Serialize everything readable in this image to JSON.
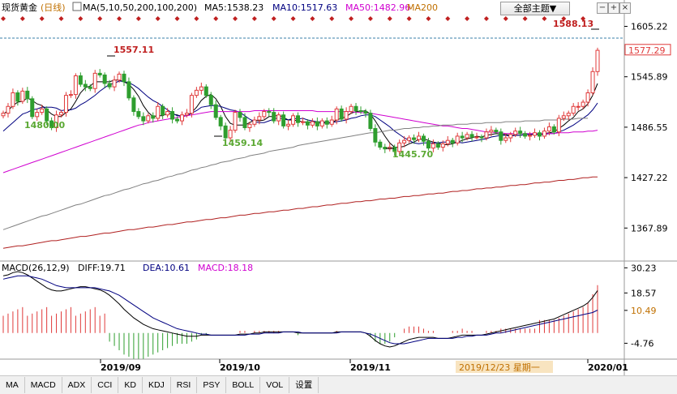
{
  "header": {
    "instrument": "现货黄金",
    "period": "(日线)",
    "ma_label": "MA(5,10,50,200,100,200)",
    "ma5": "MA5:1538.23",
    "ma10": "MA10:1517.63",
    "ma50": "MA50:1482.96",
    "ma200": "MA200",
    "theme_button": "全部主题▼",
    "ctl_minus": "−",
    "ctl_plus": "+",
    "ctl_close": "×"
  },
  "macd_header": {
    "name": "MACD(26,12,9)",
    "diff": "DIFF:19.71",
    "dea": "DEA:10.61",
    "macd": "MACD:18.18"
  },
  "annotations": {
    "high_left": "1557.11",
    "low_a": "1480.00",
    "low_b": "1459.14",
    "low_c": "1445.70",
    "high_right": "1588.13",
    "cursor_date": "2019/12/23 星期一"
  },
  "price_axis": [
    "1605.22",
    "1545.89",
    "1486.55",
    "1427.22",
    "1367.89"
  ],
  "current_price": "1577.29",
  "macd_axis": [
    "30.23",
    "18.57",
    "10.49",
    "-4.76"
  ],
  "date_axis": [
    "2019/09",
    "2019/10",
    "2019/11",
    "2020/01"
  ],
  "toolbar": [
    "MA",
    "MACD",
    "ADX",
    "CCI",
    "KD",
    "KDJ",
    "RSI",
    "PSY",
    "BOLL",
    "VOL",
    "设置"
  ],
  "colors": {
    "up": "#e03a3a",
    "down": "#2e9e2e",
    "ma5": "#000000",
    "ma10": "#000080",
    "ma50": "#d000d0",
    "ma100": "#808080",
    "ma200": "#b02020",
    "diff": "#000000",
    "dea": "#000080",
    "axis_text": "#000000",
    "annot_green": "#5aa832"
  },
  "chart_data": {
    "type": "candlestick",
    "y_range": [
      1330,
      1620
    ],
    "macd_range": [
      -11,
      33
    ],
    "closes": [
      1503,
      1511,
      1527,
      1517,
      1529,
      1520,
      1499,
      1504,
      1508,
      1494,
      1486,
      1501,
      1504,
      1524,
      1525,
      1547,
      1537,
      1534,
      1532,
      1550,
      1548,
      1538,
      1534,
      1542,
      1549,
      1540,
      1521,
      1505,
      1499,
      1494,
      1500,
      1497,
      1511,
      1501,
      1505,
      1496,
      1494,
      1501,
      1503,
      1524,
      1530,
      1534,
      1524,
      1513,
      1498,
      1488,
      1474,
      1483,
      1504,
      1498,
      1486,
      1490,
      1495,
      1499,
      1505,
      1504,
      1494,
      1501,
      1488,
      1490,
      1500,
      1492,
      1493,
      1489,
      1493,
      1488,
      1494,
      1490,
      1495,
      1508,
      1496,
      1505,
      1511,
      1506,
      1505,
      1503,
      1485,
      1469,
      1463,
      1461,
      1463,
      1458,
      1468,
      1471,
      1474,
      1472,
      1476,
      1470,
      1462,
      1467,
      1463,
      1467,
      1471,
      1468,
      1476,
      1474,
      1478,
      1475,
      1475,
      1474,
      1481,
      1483,
      1481,
      1471,
      1474,
      1478,
      1482,
      1479,
      1476,
      1477,
      1480,
      1476,
      1482,
      1487,
      1481,
      1497,
      1500,
      1503,
      1511,
      1511,
      1516,
      1527,
      1552,
      1577
    ],
    "series": [
      {
        "name": "MA5",
        "values": [
          1502,
          1506,
          1512,
          1516,
          1517,
          1521,
          1518,
          1514,
          1512,
          1507,
          1502,
          1499,
          1499,
          1504,
          1508,
          1517,
          1527,
          1533,
          1535,
          1540,
          1540,
          1540,
          1540,
          1542,
          1542,
          1540,
          1537,
          1531,
          1523,
          1512,
          1504,
          1499,
          1500,
          1500,
          1503,
          1502,
          1501,
          1499,
          1500,
          1504,
          1510,
          1518,
          1523,
          1525,
          1520,
          1511,
          1499,
          1491,
          1489,
          1489,
          1489,
          1492,
          1495,
          1494,
          1495,
          1499,
          1499,
          1501,
          1498,
          1495,
          1495,
          1494,
          1493,
          1492,
          1493,
          1491,
          1492,
          1491,
          1492,
          1495,
          1497,
          1499,
          1503,
          1505,
          1505,
          1506,
          1502,
          1494,
          1485,
          1476,
          1468,
          1463,
          1463,
          1464,
          1467,
          1469,
          1472,
          1473,
          1471,
          1469,
          1468,
          1466,
          1466,
          1467,
          1469,
          1471,
          1473,
          1474,
          1476,
          1475,
          1477,
          1478,
          1479,
          1478,
          1478,
          1477,
          1477,
          1477,
          1478,
          1478,
          1479,
          1478,
          1479,
          1480,
          1481,
          1485,
          1489,
          1494,
          1498,
          1505,
          1508,
          1514,
          1524,
          1538
        ]
      },
      {
        "name": "MA10",
        "values": [
          1482,
          1487,
          1492,
          1497,
          1502,
          1504,
          1507,
          1508,
          1510,
          1510,
          1510,
          1509,
          1506,
          1507,
          1507,
          1509,
          1513,
          1516,
          1520,
          1524,
          1529,
          1533,
          1537,
          1538,
          1541,
          1540,
          1539,
          1536,
          1532,
          1527,
          1522,
          1518,
          1515,
          1511,
          1507,
          1503,
          1500,
          1500,
          1500,
          1503,
          1506,
          1510,
          1511,
          1512,
          1512,
          1511,
          1509,
          1507,
          1506,
          1504,
          1500,
          1496,
          1493,
          1492,
          1492,
          1494,
          1496,
          1498,
          1496,
          1495,
          1497,
          1496,
          1497,
          1495,
          1494,
          1493,
          1493,
          1492,
          1492,
          1493,
          1494,
          1495,
          1497,
          1498,
          1500,
          1501,
          1501,
          1499,
          1495,
          1491,
          1487,
          1482,
          1478,
          1474,
          1471,
          1468,
          1467,
          1468,
          1468,
          1468,
          1468,
          1469,
          1469,
          1469,
          1469,
          1468,
          1469,
          1470,
          1471,
          1472,
          1473,
          1475,
          1476,
          1477,
          1477,
          1476,
          1477,
          1477,
          1478,
          1478,
          1478,
          1478,
          1478,
          1479,
          1479,
          1481,
          1483,
          1486,
          1489,
          1493,
          1497,
          1501,
          1507,
          1515
        ]
      },
      {
        "name": "MA50",
        "values": [
          1433,
          1435,
          1437,
          1439,
          1441,
          1443,
          1445,
          1447,
          1449,
          1451,
          1453,
          1455,
          1457,
          1459,
          1461,
          1463,
          1465,
          1467,
          1469,
          1471,
          1473,
          1475,
          1477,
          1479,
          1481,
          1483,
          1485,
          1487,
          1489,
          1490,
          1492,
          1493,
          1494,
          1495,
          1496,
          1497,
          1498,
          1499,
          1500,
          1501,
          1502,
          1503,
          1504,
          1505,
          1505,
          1505,
          1505,
          1505,
          1505,
          1505,
          1505,
          1505,
          1506,
          1506,
          1506,
          1506,
          1506,
          1506,
          1506,
          1506,
          1506,
          1506,
          1506,
          1506,
          1506,
          1505,
          1505,
          1505,
          1505,
          1505,
          1505,
          1505,
          1505,
          1504,
          1504,
          1503,
          1503,
          1502,
          1501,
          1500,
          1499,
          1498,
          1497,
          1496,
          1495,
          1494,
          1493,
          1492,
          1491,
          1490,
          1489,
          1488,
          1488,
          1487,
          1486,
          1485,
          1485,
          1484,
          1483,
          1482,
          1481,
          1481,
          1480,
          1480,
          1479,
          1479,
          1479,
          1479,
          1479,
          1479,
          1479,
          1479,
          1479,
          1479,
          1479,
          1480,
          1480,
          1480,
          1481,
          1481,
          1481,
          1482,
          1482,
          1483
        ]
      },
      {
        "name": "MA100",
        "values": [
          1366,
          1368,
          1370,
          1372,
          1374,
          1376,
          1378,
          1380,
          1382,
          1383,
          1385,
          1387,
          1389,
          1391,
          1393,
          1395,
          1396,
          1398,
          1400,
          1402,
          1404,
          1406,
          1407,
          1409,
          1411,
          1413,
          1414,
          1416,
          1418,
          1420,
          1421,
          1423,
          1424,
          1426,
          1428,
          1429,
          1431,
          1432,
          1434,
          1436,
          1437,
          1439,
          1440,
          1442,
          1443,
          1445,
          1446,
          1447,
          1449,
          1450,
          1451,
          1453,
          1454,
          1455,
          1456,
          1458,
          1459,
          1460,
          1461,
          1462,
          1463,
          1465,
          1466,
          1467,
          1468,
          1469,
          1470,
          1471,
          1472,
          1473,
          1474,
          1475,
          1476,
          1477,
          1478,
          1479,
          1480,
          1480,
          1481,
          1482,
          1483,
          1483,
          1484,
          1485,
          1485,
          1486,
          1486,
          1487,
          1487,
          1488,
          1488,
          1489,
          1489,
          1489,
          1490,
          1490,
          1490,
          1491,
          1491,
          1491,
          1492,
          1492,
          1492,
          1492,
          1493,
          1493,
          1493,
          1493,
          1494,
          1494,
          1494,
          1494,
          1495,
          1495,
          1495,
          1495,
          1496,
          1496,
          1496,
          1497,
          1497,
          1497
        ]
      },
      {
        "name": "MA200",
        "values": [
          1344,
          1345,
          1346,
          1347,
          1347,
          1348,
          1349,
          1350,
          1351,
          1352,
          1353,
          1353,
          1354,
          1355,
          1356,
          1357,
          1358,
          1358,
          1359,
          1360,
          1361,
          1362,
          1362,
          1363,
          1364,
          1365,
          1366,
          1366,
          1367,
          1368,
          1369,
          1369,
          1370,
          1371,
          1372,
          1372,
          1373,
          1374,
          1375,
          1375,
          1376,
          1377,
          1378,
          1378,
          1379,
          1380,
          1380,
          1381,
          1382,
          1383,
          1383,
          1384,
          1385,
          1385,
          1386,
          1387,
          1387,
          1388,
          1389,
          1389,
          1390,
          1391,
          1391,
          1392,
          1393,
          1393,
          1394,
          1395,
          1395,
          1396,
          1397,
          1397,
          1398,
          1399,
          1399,
          1400,
          1400,
          1401,
          1402,
          1402,
          1403,
          1403,
          1404,
          1405,
          1405,
          1406,
          1406,
          1407,
          1408,
          1408,
          1409,
          1409,
          1410,
          1411,
          1411,
          1412,
          1412,
          1413,
          1414,
          1414,
          1415,
          1415,
          1416,
          1416,
          1417,
          1418,
          1418,
          1419,
          1419,
          1420,
          1421,
          1421,
          1422,
          1422,
          1423,
          1424,
          1424,
          1425,
          1425,
          1426,
          1427,
          1427,
          1428,
          1428
        ]
      }
    ],
    "macd": {
      "diff": [
        26.5,
        27,
        28,
        28.5,
        28,
        27,
        25.5,
        24,
        22.5,
        21,
        20,
        19.5,
        19.5,
        20,
        20.5,
        21,
        21.5,
        21.5,
        21,
        20.5,
        20,
        19,
        17.5,
        15.5,
        13.5,
        11,
        9,
        7,
        5.5,
        4,
        3,
        2,
        1.5,
        1,
        0.5,
        0,
        -0.5,
        -1,
        -1.5,
        -1.5,
        -1.5,
        -1,
        -1,
        -1,
        -1,
        -1,
        -1,
        -1,
        -1,
        -0.5,
        -0.5,
        -0.5,
        0,
        0,
        0.5,
        0.5,
        0.5,
        0.5,
        0.5,
        0.5,
        0.5,
        0,
        0,
        0,
        0,
        0,
        0,
        0,
        0,
        0.5,
        0.5,
        0.5,
        0.5,
        0.5,
        0.5,
        0,
        -1.5,
        -3.5,
        -5,
        -6,
        -6.5,
        -6,
        -5,
        -4,
        -3,
        -2.5,
        -2,
        -2,
        -2,
        -2,
        -2.5,
        -2.5,
        -2.5,
        -2,
        -1.5,
        -1,
        -1,
        -1,
        -1,
        -1,
        -0.5,
        0,
        0.5,
        1,
        1.5,
        2,
        2.5,
        3,
        3.5,
        4,
        4.5,
        5,
        5.5,
        6,
        6.5,
        7.5,
        8.5,
        9.5,
        10.5,
        11.5,
        12.5,
        14,
        16.5,
        19.7
      ],
      "dea": [
        25,
        25.5,
        26,
        26.5,
        26.5,
        26.5,
        26,
        25.5,
        25,
        24,
        23,
        22,
        21.5,
        21,
        21,
        21,
        21,
        21,
        21,
        21,
        20.5,
        20,
        19.5,
        18.5,
        17.5,
        16,
        14.5,
        13,
        11.5,
        10,
        8.5,
        7,
        6,
        5,
        4,
        3,
        2,
        1.5,
        1,
        0.5,
        0,
        -0.5,
        -0.5,
        -1,
        -1,
        -1,
        -1,
        -1,
        -1,
        -1,
        -1,
        -0.5,
        -0.5,
        -0.5,
        0,
        0,
        0,
        0,
        0.5,
        0.5,
        0.5,
        0.5,
        0,
        0,
        0,
        0,
        0,
        0,
        0,
        0,
        0.5,
        0.5,
        0.5,
        0.5,
        0.5,
        0,
        -0.5,
        -1.5,
        -2.5,
        -3.5,
        -4.5,
        -5,
        -5,
        -5,
        -4.5,
        -4,
        -3.5,
        -3,
        -2.5,
        -2.5,
        -2.5,
        -2.5,
        -2.5,
        -2.5,
        -2,
        -2,
        -1.5,
        -1.5,
        -1,
        -1,
        -1,
        -0.5,
        0,
        0,
        0.5,
        1,
        1.5,
        2,
        2.5,
        3,
        3.5,
        4,
        4.5,
        5,
        5.5,
        6,
        6.5,
        7,
        7.5,
        8,
        8.5,
        9,
        9.5,
        10.61
      ]
    },
    "high_marks": [
      "1557.11",
      "1588.13"
    ],
    "low_marks": [
      "1480.00",
      "1459.14",
      "1445.70"
    ]
  }
}
